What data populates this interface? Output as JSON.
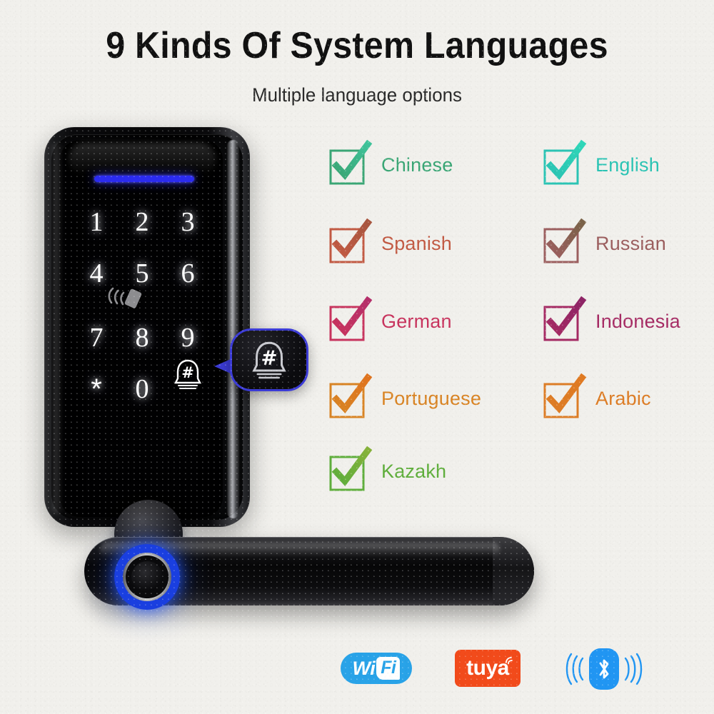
{
  "header": {
    "title": "9 Kinds Of System Languages",
    "subtitle": "Multiple language options"
  },
  "product": {
    "name": "smart-door-lock",
    "keypad": {
      "keys": [
        "1",
        "2",
        "3",
        "4",
        "5",
        "6",
        "7",
        "8",
        "9",
        "*",
        "0"
      ],
      "bell_key_label": "#",
      "rfid_icon": "rfid-card-icon",
      "indicator_color": "#2b2bf0"
    },
    "callout": {
      "icon": "doorbell-hash-icon",
      "label": "#",
      "border_color": "#3b3bd6"
    },
    "fingerprint": {
      "icon": "fingerprint-reader-icon",
      "ring_color": "#2455ff"
    }
  },
  "languages": [
    {
      "label": "Chinese",
      "color": "#3aa675",
      "check_top": "#3fc39a",
      "column": 0,
      "row": 0
    },
    {
      "label": "English",
      "color": "#2bc4b4",
      "check_top": "#2fd6b8",
      "column": 1,
      "row": 0
    },
    {
      "label": "Spanish",
      "color": "#c25a43",
      "check_top": "#a8563f",
      "column": 0,
      "row": 1
    },
    {
      "label": "Russian",
      "color": "#9c5f5f",
      "check_top": "#7a6248",
      "column": 1,
      "row": 1
    },
    {
      "label": "German",
      "color": "#c8345e",
      "check_top": "#b52f6a",
      "column": 0,
      "row": 2
    },
    {
      "label": "Indonesia",
      "color": "#a52a63",
      "check_top": "#8e2566",
      "column": 1,
      "row": 2
    },
    {
      "label": "Portuguese",
      "color": "#d98424",
      "check_top": "#e0741f",
      "column": 0,
      "row": 3
    },
    {
      "label": "Arabic",
      "color": "#dd7d26",
      "check_top": "#e07a22",
      "column": 1,
      "row": 3
    },
    {
      "label": "Kazakh",
      "color": "#5fae3c",
      "check_top": "#86b23a",
      "column": 0,
      "row": 4
    }
  ],
  "badges": {
    "wifi": {
      "prefix": "Wi",
      "suffix": "Fi",
      "color": "#29a3e8"
    },
    "tuya": {
      "label": "tuya",
      "color": "#f24b1b"
    },
    "bluetooth": {
      "icon": "bluetooth-icon",
      "color": "#2196f3"
    }
  }
}
